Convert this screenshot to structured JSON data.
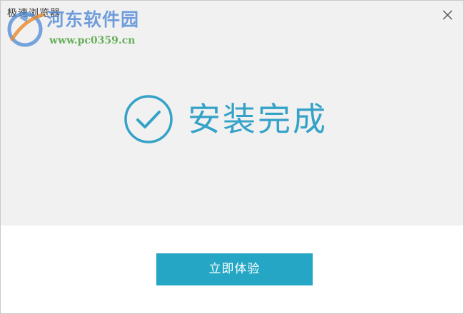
{
  "window": {
    "title": "极速浏览器",
    "close_icon": "close-icon"
  },
  "watermark": {
    "name": "河东软件园",
    "url": "www.pc0359.cn"
  },
  "status": {
    "icon": "checkmark-circle-icon",
    "text": "安装完成",
    "color": "#35a2c7"
  },
  "action": {
    "label": "立即体验",
    "color": "#25a6c5"
  }
}
